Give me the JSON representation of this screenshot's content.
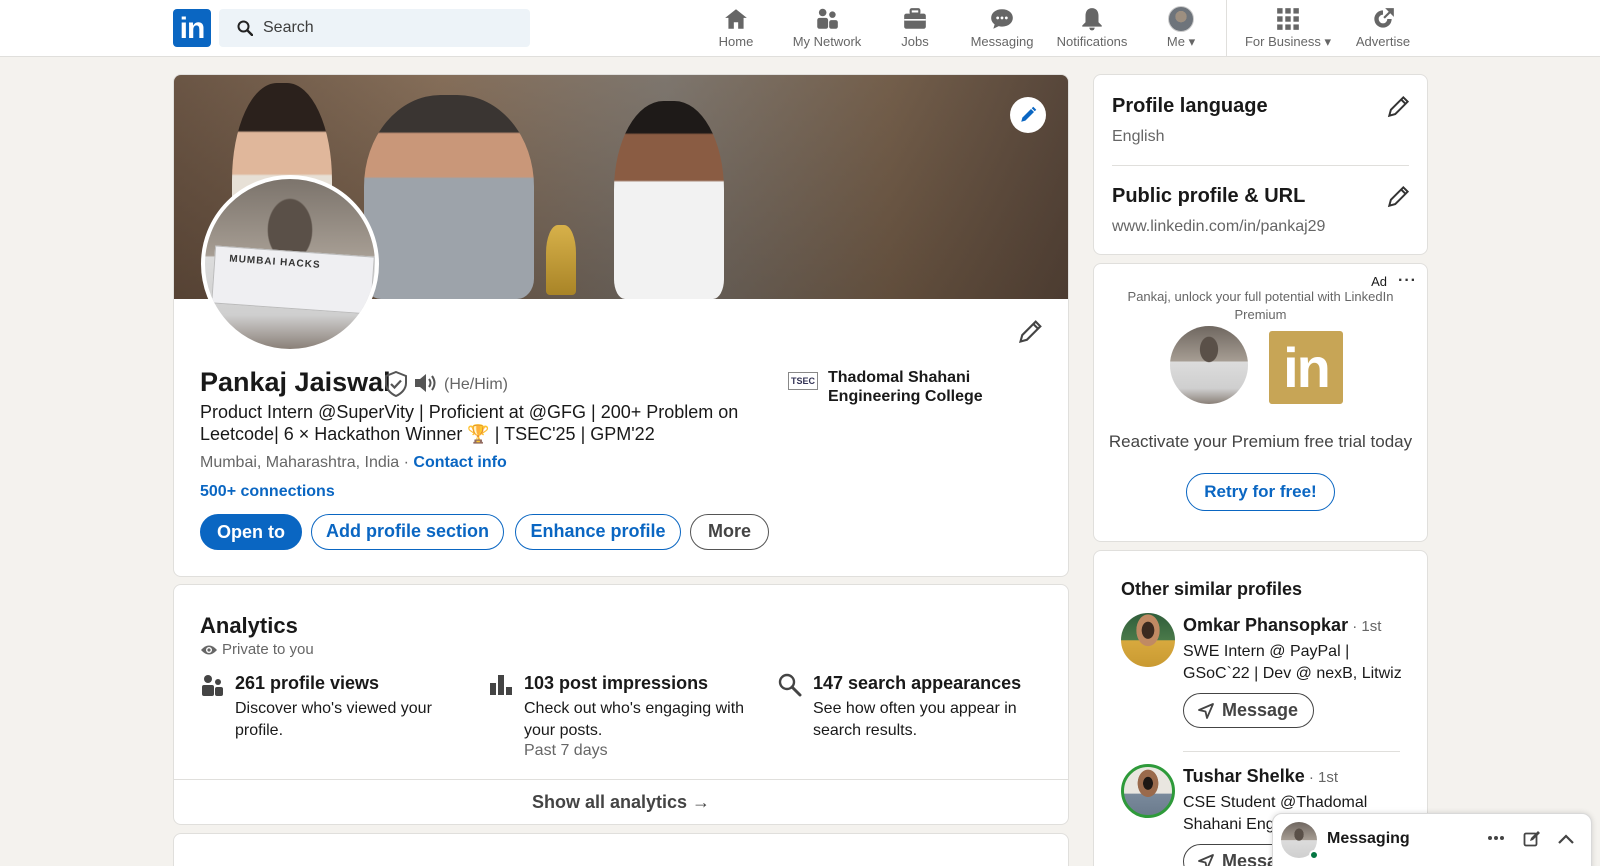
{
  "nav": {
    "logo_text": "in",
    "search_placeholder": "Search",
    "items": [
      {
        "label": "Home",
        "icon": "home-icon"
      },
      {
        "label": "My Network",
        "icon": "network-icon"
      },
      {
        "label": "Jobs",
        "icon": "briefcase-icon"
      },
      {
        "label": "Messaging",
        "icon": "chat-icon"
      },
      {
        "label": "Notifications",
        "icon": "bell-icon"
      },
      {
        "label": "Me",
        "icon": "avatar"
      },
      {
        "label": "For Business",
        "icon": "grid-icon"
      },
      {
        "label": "Advertise",
        "icon": "advertise-icon"
      }
    ]
  },
  "profile": {
    "name": "Pankaj Jaiswal",
    "pronouns": "(He/Him)",
    "headline": "Product Intern @SuperVity | Proficient at @GFG | 200+ Problem on Leetcode| 6 × Hackathon Winner 🏆 | TSEC'25 | GPM'22",
    "location": "Mumbai, Maharashtra, India",
    "location_sep": " · ",
    "contact_info": "Contact info",
    "connections": "500+ connections",
    "education": {
      "logo_text": "TSEC",
      "name": "Thadomal Shahani Engineering College"
    },
    "cheque_text": "MUMBAI HACKS",
    "buttons": {
      "open_to": "Open to",
      "add_section": "Add profile section",
      "enhance": "Enhance profile",
      "more": "More"
    }
  },
  "analytics": {
    "title": "Analytics",
    "private": "Private to you",
    "stats": [
      {
        "title": "261 profile views",
        "desc": "Discover who's viewed your profile.",
        "sub": ""
      },
      {
        "title": "103 post impressions",
        "desc": "Check out who's engaging with your posts.",
        "sub": "Past 7 days"
      },
      {
        "title": "147 search appearances",
        "desc": "See how often you appear in search results.",
        "sub": ""
      }
    ],
    "show_all": "Show all analytics →"
  },
  "sidebar": {
    "language_title": "Profile language",
    "language_value": "English",
    "url_title": "Public profile & URL",
    "url_value": "www.linkedin.com/in/pankaj29"
  },
  "ad": {
    "label": "Ad",
    "dots": "···",
    "text": "Pankaj, unlock your full potential with LinkedIn Premium",
    "logo_text": "in",
    "cta_text": "Reactivate your Premium free trial today",
    "button": "Retry for free!"
  },
  "similar": {
    "title": "Other similar profiles",
    "profiles": [
      {
        "name": "Omkar Phansopkar",
        "degree": " · 1st",
        "desc": "SWE Intern @ PayPal | GSoC`22 | Dev @ nexB, Litwiz",
        "button": "Message"
      },
      {
        "name": "Tushar Shelke",
        "degree": " · 1st",
        "desc": "CSE Student @Thadomal Shahani Eng",
        "button": "Messa"
      }
    ]
  },
  "dock": {
    "label": "Messaging"
  },
  "colors": {
    "brand": "#0a66c2",
    "premium_gold": "#c7a556",
    "online": "#057642"
  }
}
